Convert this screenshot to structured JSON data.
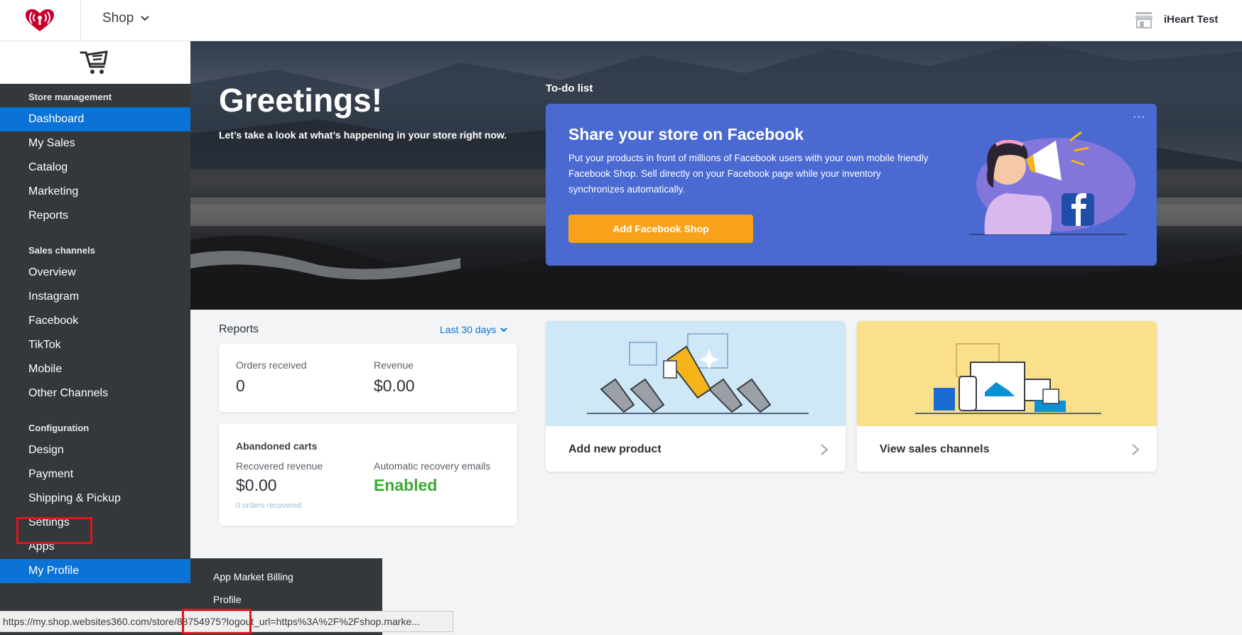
{
  "topbar": {
    "shop_label": "Shop",
    "user_name": "iHeart Test"
  },
  "sidebar": {
    "sections": [
      {
        "header": "Store management",
        "items": [
          "Dashboard",
          "My Sales",
          "Catalog",
          "Marketing",
          "Reports"
        ]
      },
      {
        "header": "Sales channels",
        "items": [
          "Overview",
          "Instagram",
          "Facebook",
          "TikTok",
          "Mobile",
          "Other Channels"
        ]
      },
      {
        "header": "Configuration",
        "items": [
          "Design",
          "Payment",
          "Shipping & Pickup",
          "Settings",
          "Apps",
          "My Profile"
        ]
      }
    ],
    "active_item": "Dashboard",
    "highlighted_item": "My Profile"
  },
  "hero": {
    "greeting": "Greetings!",
    "subtitle": "Let’s take a look at what’s happening in your store right now.",
    "todo_title": "To-do list"
  },
  "facebook_card": {
    "title": "Share your store on Facebook",
    "description": "Put your products in front of millions of Facebook users with your own mobile friendly Facebook Shop. Sell directly on your Facebook page while your inventory synchronizes automatically.",
    "button_label": "Add Facebook Shop",
    "more_label": "···",
    "accent_color": "#4a69d1",
    "button_color": "#f7a21a"
  },
  "reports": {
    "title": "Reports",
    "range_label": "Last 30 days",
    "orders_label": "Orders received",
    "orders_value": "0",
    "revenue_label": "Revenue",
    "revenue_value": "$0.00",
    "abandoned_title": "Abandoned carts",
    "recovered_label": "Recovered revenue",
    "recovered_value": "$0.00",
    "recovered_orders": "0 orders recovered",
    "emails_label": "Automatic recovery emails",
    "emails_value": "Enabled"
  },
  "tiles": {
    "add_product": "Add new product",
    "view_channels": "View sales channels"
  },
  "profile_menu": {
    "items": [
      "App Market Billing",
      "Profile"
    ]
  },
  "statusbar": {
    "url": "https://my.shop.websites360.com/store/88754975?logout_url=https%3A%2F%2Fshop.marke..."
  },
  "colors": {
    "sidebar_bg": "#33383d",
    "active_blue": "#0b73d6",
    "highlight_red": "#e2131b",
    "enabled_green": "#3aaa35"
  }
}
